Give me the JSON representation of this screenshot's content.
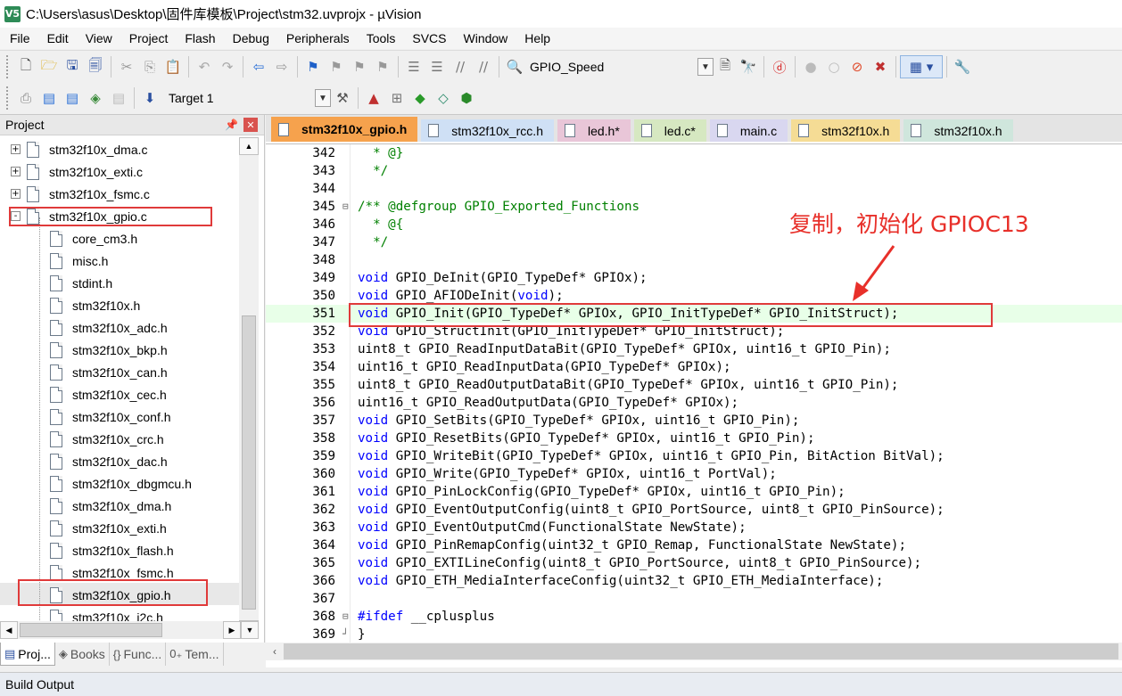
{
  "window": {
    "title": "C:\\Users\\asus\\Desktop\\固件库模板\\Project\\stm32.uvprojx - µVision",
    "icon_text": "V5"
  },
  "menu": [
    "File",
    "Edit",
    "View",
    "Project",
    "Flash",
    "Debug",
    "Peripherals",
    "Tools",
    "SVCS",
    "Window",
    "Help"
  ],
  "toolbar": {
    "find_combo_value": "GPIO_Speed",
    "target_combo_value": "Target 1"
  },
  "project_panel": {
    "title": "Project",
    "tree": [
      {
        "label": "stm32f10x_dma.c",
        "level": 1,
        "expander": "+"
      },
      {
        "label": "stm32f10x_exti.c",
        "level": 1,
        "expander": "+"
      },
      {
        "label": "stm32f10x_fsmc.c",
        "level": 1,
        "expander": "+"
      },
      {
        "label": "stm32f10x_gpio.c",
        "level": 1,
        "expander": "-"
      },
      {
        "label": "core_cm3.h",
        "level": 2
      },
      {
        "label": "misc.h",
        "level": 2
      },
      {
        "label": "stdint.h",
        "level": 2
      },
      {
        "label": "stm32f10x.h",
        "level": 2
      },
      {
        "label": "stm32f10x_adc.h",
        "level": 2
      },
      {
        "label": "stm32f10x_bkp.h",
        "level": 2
      },
      {
        "label": "stm32f10x_can.h",
        "level": 2
      },
      {
        "label": "stm32f10x_cec.h",
        "level": 2
      },
      {
        "label": "stm32f10x_conf.h",
        "level": 2
      },
      {
        "label": "stm32f10x_crc.h",
        "level": 2
      },
      {
        "label": "stm32f10x_dac.h",
        "level": 2
      },
      {
        "label": "stm32f10x_dbgmcu.h",
        "level": 2
      },
      {
        "label": "stm32f10x_dma.h",
        "level": 2
      },
      {
        "label": "stm32f10x_exti.h",
        "level": 2
      },
      {
        "label": "stm32f10x_flash.h",
        "level": 2
      },
      {
        "label": "stm32f10x_fsmc.h",
        "level": 2
      },
      {
        "label": "stm32f10x_gpio.h",
        "level": 2
      },
      {
        "label": "stm32f10x_i2c.h",
        "level": 2
      }
    ],
    "tabs": [
      "Proj...",
      "Books",
      "Func...",
      "Tem..."
    ]
  },
  "editor": {
    "tabs": [
      {
        "label": "stm32f10x_gpio.h",
        "color": "#f6a24d",
        "active": true
      },
      {
        "label": "stm32f10x_rcc.h",
        "color": "#cfe0f5",
        "active": false
      },
      {
        "label": "led.h*",
        "color": "#e9c6d8",
        "active": false
      },
      {
        "label": "led.c*",
        "color": "#d6e8c1",
        "active": false
      },
      {
        "label": "main.c",
        "color": "#d9d7f0",
        "active": false
      },
      {
        "label": "stm32f10x.h",
        "color": "#f5dc95",
        "active": false
      },
      {
        "label": "stm32f10x.h",
        "color": "#cfe6dc",
        "active": false
      }
    ],
    "lines": [
      {
        "num": "342",
        "fold": "",
        "text": "  * @}",
        "type": "comment"
      },
      {
        "num": "343",
        "fold": "",
        "text": "  */",
        "type": "comment"
      },
      {
        "num": "344",
        "fold": "",
        "text": "",
        "type": "plain"
      },
      {
        "num": "345",
        "fold": "⊟",
        "text": "/** @defgroup GPIO_Exported_Functions",
        "type": "comment"
      },
      {
        "num": "346",
        "fold": "",
        "text": "  * @{",
        "type": "comment"
      },
      {
        "num": "347",
        "fold": "",
        "text": "  */",
        "type": "comment"
      },
      {
        "num": "348",
        "fold": "",
        "text": "",
        "type": "plain"
      },
      {
        "num": "349",
        "fold": "",
        "kw": "void",
        "text": " GPIO_DeInit(GPIO_TypeDef* GPIOx);",
        "type": "code"
      },
      {
        "num": "350",
        "fold": "",
        "kw": "void",
        "text": " GPIO_AFIODeInit(",
        "kw2": "void",
        "tail": ");",
        "type": "code2"
      },
      {
        "num": "351",
        "fold": "",
        "kw": "void",
        "text": " GPIO_Init(GPIO_TypeDef* GPIOx, GPIO_InitTypeDef* GPIO_InitStruct);",
        "type": "code",
        "highlight": true
      },
      {
        "num": "352",
        "fold": "",
        "kw": "void",
        "text": " GPIO_StructInit(GPIO_InitTypeDef* GPIO_InitStruct);",
        "type": "code"
      },
      {
        "num": "353",
        "fold": "",
        "kw": "",
        "text": "uint8_t GPIO_ReadInputDataBit(GPIO_TypeDef* GPIOx, uint16_t GPIO_Pin);",
        "type": "code"
      },
      {
        "num": "354",
        "fold": "",
        "kw": "",
        "text": "uint16_t GPIO_ReadInputData(GPIO_TypeDef* GPIOx);",
        "type": "code"
      },
      {
        "num": "355",
        "fold": "",
        "kw": "",
        "text": "uint8_t GPIO_ReadOutputDataBit(GPIO_TypeDef* GPIOx, uint16_t GPIO_Pin);",
        "type": "code"
      },
      {
        "num": "356",
        "fold": "",
        "kw": "",
        "text": "uint16_t GPIO_ReadOutputData(GPIO_TypeDef* GPIOx);",
        "type": "code"
      },
      {
        "num": "357",
        "fold": "",
        "kw": "void",
        "text": " GPIO_SetBits(GPIO_TypeDef* GPIOx, uint16_t GPIO_Pin);",
        "type": "code"
      },
      {
        "num": "358",
        "fold": "",
        "kw": "void",
        "text": " GPIO_ResetBits(GPIO_TypeDef* GPIOx, uint16_t GPIO_Pin);",
        "type": "code"
      },
      {
        "num": "359",
        "fold": "",
        "kw": "void",
        "text": " GPIO_WriteBit(GPIO_TypeDef* GPIOx, uint16_t GPIO_Pin, BitAction BitVal);",
        "type": "code"
      },
      {
        "num": "360",
        "fold": "",
        "kw": "void",
        "text": " GPIO_Write(GPIO_TypeDef* GPIOx, uint16_t PortVal);",
        "type": "code"
      },
      {
        "num": "361",
        "fold": "",
        "kw": "void",
        "text": " GPIO_PinLockConfig(GPIO_TypeDef* GPIOx, uint16_t GPIO_Pin);",
        "type": "code"
      },
      {
        "num": "362",
        "fold": "",
        "kw": "void",
        "text": " GPIO_EventOutputConfig(uint8_t GPIO_PortSource, uint8_t GPIO_PinSource);",
        "type": "code"
      },
      {
        "num": "363",
        "fold": "",
        "kw": "void",
        "text": " GPIO_EventOutputCmd(FunctionalState NewState);",
        "type": "code"
      },
      {
        "num": "364",
        "fold": "",
        "kw": "void",
        "text": " GPIO_PinRemapConfig(uint32_t GPIO_Remap, FunctionalState NewState);",
        "type": "code"
      },
      {
        "num": "365",
        "fold": "",
        "kw": "void",
        "text": " GPIO_EXTILineConfig(uint8_t GPIO_PortSource, uint8_t GPIO_PinSource);",
        "type": "code"
      },
      {
        "num": "366",
        "fold": "",
        "kw": "void",
        "text": " GPIO_ETH_MediaInterfaceConfig(uint32_t GPIO_ETH_MediaInterface);",
        "type": "code"
      },
      {
        "num": "367",
        "fold": "",
        "text": "",
        "type": "plain"
      },
      {
        "num": "368",
        "fold": "⊟",
        "kw": "#ifdef",
        "text": " __cplusplus",
        "type": "code"
      },
      {
        "num": "369",
        "fold": "┘",
        "text": "}",
        "type": "plain"
      }
    ]
  },
  "annotation_text": "复制，初始化 GPIOC13",
  "build_output": {
    "title": "Build Output"
  },
  "colors": {
    "annotation": "#e8302a",
    "keyword": "#0000ff",
    "comment": "#008000"
  }
}
